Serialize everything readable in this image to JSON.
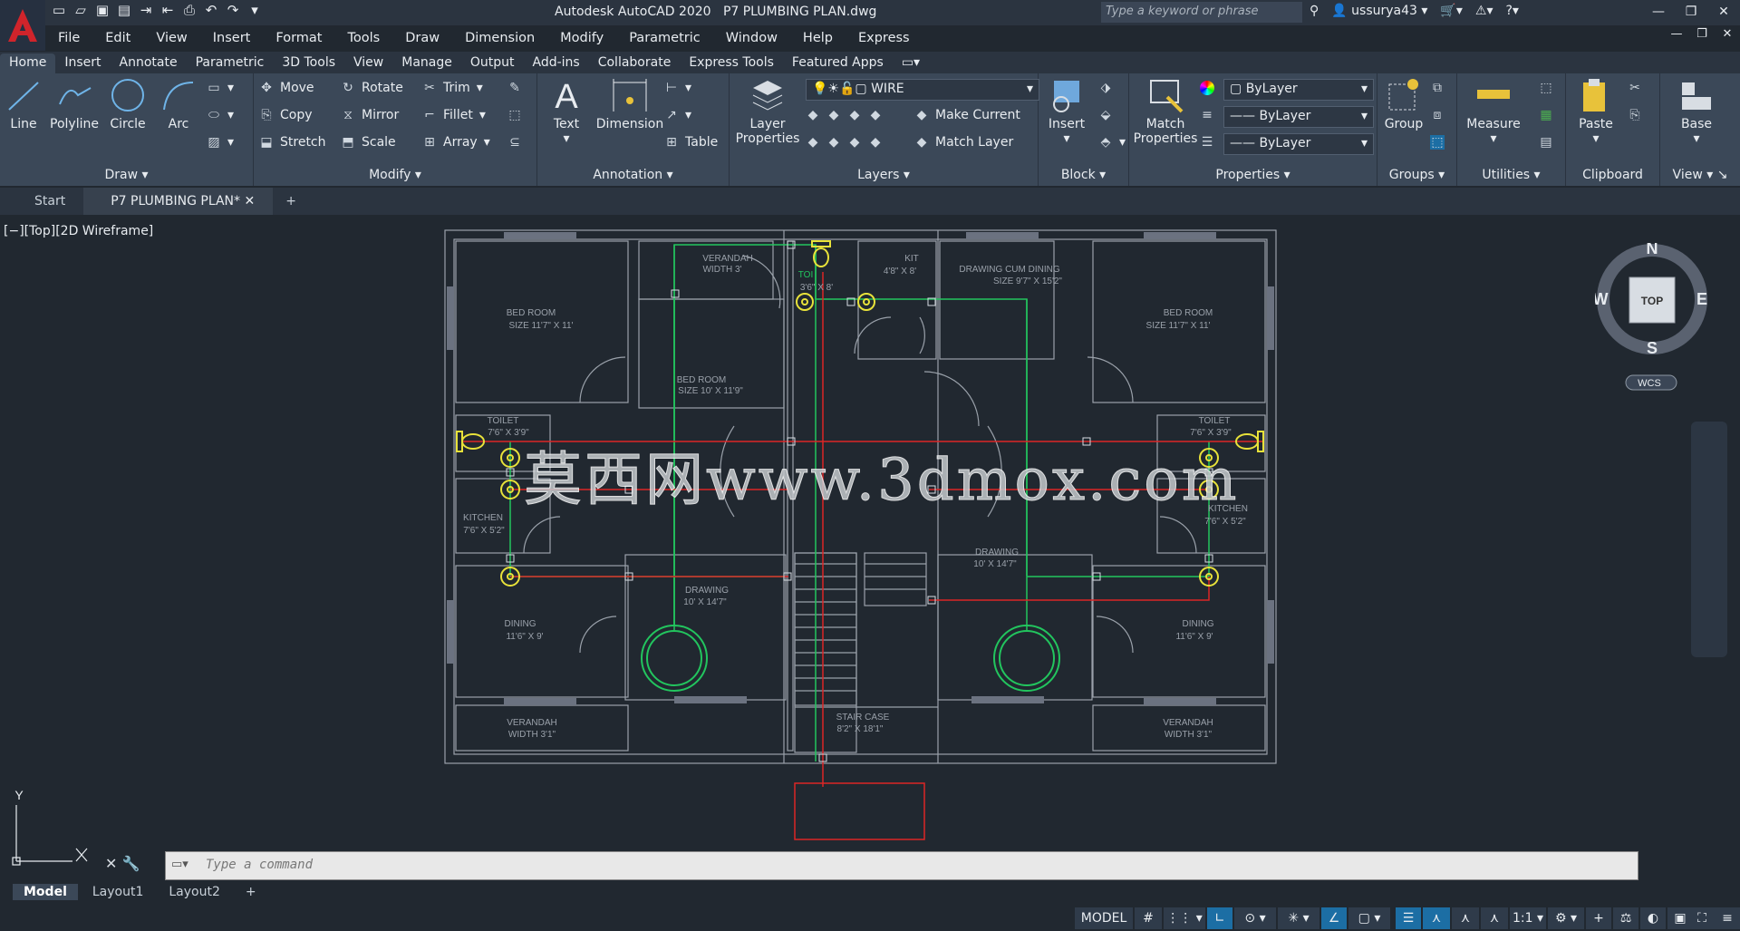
{
  "titlebar": {
    "app_title": "Autodesk AutoCAD 2020",
    "file_title": "P7 PLUMBING PLAN.dwg",
    "search_placeholder": "Type a keyword or phrase",
    "username": "ussurya43"
  },
  "menu": [
    "File",
    "Edit",
    "View",
    "Insert",
    "Format",
    "Tools",
    "Draw",
    "Dimension",
    "Modify",
    "Parametric",
    "Window",
    "Help",
    "Express"
  ],
  "ribbon_tabs": [
    "Home",
    "Insert",
    "Annotate",
    "Parametric",
    "3D Tools",
    "View",
    "Manage",
    "Output",
    "Add-ins",
    "Collaborate",
    "Express Tools",
    "Featured Apps"
  ],
  "active_ribbon_tab": "Home",
  "ribbon": {
    "draw": {
      "label": "Draw",
      "line": "Line",
      "polyline": "Polyline",
      "circle": "Circle",
      "arc": "Arc"
    },
    "modify": {
      "label": "Modify",
      "move": "Move",
      "rotate": "Rotate",
      "trim": "Trim",
      "copy": "Copy",
      "mirror": "Mirror",
      "fillet": "Fillet",
      "stretch": "Stretch",
      "scale": "Scale",
      "array": "Array"
    },
    "annotation": {
      "label": "Annotation",
      "text": "Text",
      "dimension": "Dimension",
      "table": "Table"
    },
    "layers": {
      "label": "Layers",
      "layer_properties": "Layer Properties",
      "current_layer": "WIRE",
      "make_current": "Make Current",
      "match_layer": "Match Layer"
    },
    "block": {
      "label": "Block",
      "insert": "Insert"
    },
    "properties": {
      "label": "Properties",
      "match_properties": "Match Properties",
      "color": "ByLayer",
      "linetype": "ByLayer",
      "lineweight": "ByLayer"
    },
    "groups": {
      "label": "Groups",
      "group": "Group"
    },
    "utilities": {
      "label": "Utilities",
      "measure": "Measure"
    },
    "clipboard": {
      "label": "Clipboard",
      "paste": "Paste"
    },
    "view": {
      "label": "View",
      "base": "Base"
    }
  },
  "doc_tabs": {
    "start": "Start",
    "active": "P7 PLUMBING PLAN*"
  },
  "viewport_label": "[−][Top][2D Wireframe]",
  "viewcube": {
    "n": "N",
    "s": "S",
    "e": "E",
    "w": "W",
    "face": "TOP",
    "ucs": "WCS"
  },
  "ucs_y": "Y",
  "command_placeholder": "Type a command",
  "layout_tabs": [
    "Model",
    "Layout1",
    "Layout2"
  ],
  "status": {
    "model": "MODEL",
    "scale": "1:1"
  },
  "watermark": "莫西网www.3dmox.com",
  "plan_labels": {
    "verandah_top": "VERANDAH",
    "verandah_top_size": "WIDTH 3'",
    "toi": "TOI",
    "toi_size": "3'6\" X 8'",
    "kit": "KIT",
    "kit_size": "4'8\" X 8'",
    "drawing_dining": "DRAWING CUM DINING",
    "drawing_dining_size": "SIZE 9'7\" X 15'2\"",
    "bed_left": "BED ROOM",
    "bed_left_size": "SIZE 11'7\" X 11'",
    "bed_right": "BED ROOM",
    "bed_right_size": "SIZE 11'7\" X 11'",
    "bed_mid": "BED ROOM",
    "bed_mid_size": "SIZE 10' X 11'9\"",
    "toilet_left": "TOILET",
    "toilet_left_size": "7'6\" X 3'9\"",
    "toilet_right": "TOILET",
    "toilet_right_size": "7'6\" X 3'9\"",
    "kitchen_left": "KITCHEN",
    "kitchen_left_size": "7'6\" X 5'2\"",
    "kitchen_right": "KITCHEN",
    "kitchen_right_size": "7'6\" X 5'2\"",
    "drawing_left": "DRAWING",
    "drawing_left_size": "10' X 14'7\"",
    "drawing_right": "DRAWING",
    "drawing_right_size": "10' X 14'7\"",
    "dining_left": "DINING",
    "dining_left_size": "11'6\" X 9'",
    "dining_right": "DINING",
    "dining_right_size": "11'6\" X 9'",
    "stair": "STAIR CASE",
    "stair_size": "8'2\" X 18'1\"",
    "ver_bl": "VERANDAH",
    "ver_bl_size": "WIDTH 3'1\"",
    "ver_br": "VERANDAH",
    "ver_br_size": "WIDTH 3'1\""
  }
}
